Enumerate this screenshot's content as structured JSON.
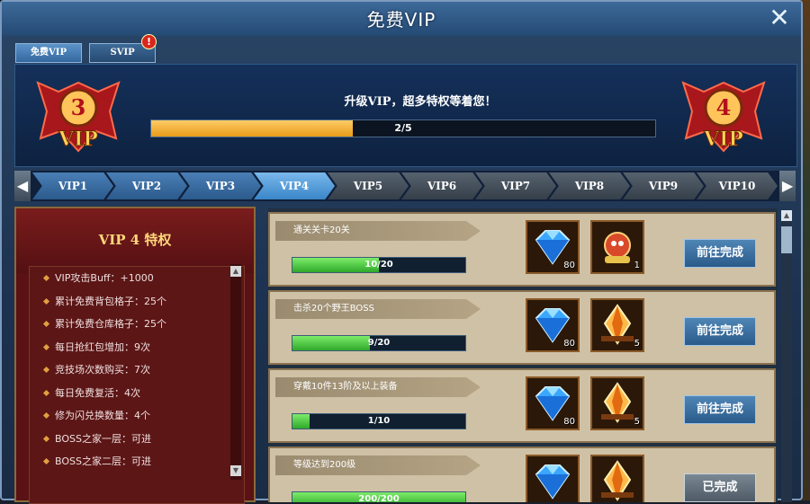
{
  "window": {
    "title": "免费VIP",
    "close_icon": "close-icon"
  },
  "tabs": [
    {
      "label": "免费VIP",
      "active": true
    },
    {
      "label": "SVIP",
      "active": false,
      "badge": "!"
    }
  ],
  "header": {
    "text": "升级VIP，超多特权等着您！",
    "current_level": "3",
    "next_level": "4",
    "badge_word": "VIP",
    "progress_text": "2/5",
    "progress": 0.4
  },
  "levels": [
    "VIP1",
    "VIP2",
    "VIP3",
    "VIP4",
    "VIP5",
    "VIP6",
    "VIP7",
    "VIP8",
    "VIP9",
    "VIP10"
  ],
  "selected_level": "VIP4",
  "privileges": {
    "title": "VIP 4 特权",
    "items": [
      "VIP攻击Buff：+1000",
      "累计免费背包格子：25个",
      "累计免费仓库格子：25个",
      "每日抢红包增加：9次",
      "竞技场次数购买：7次",
      "每日免费复活：4次",
      "修为闪兑换数量：4个",
      "BOSS之家一层：可进",
      "BOSS之家二层：可进"
    ]
  },
  "tasks": [
    {
      "name": "通关关卡20关",
      "progress_text": "10/20",
      "progress": 0.5,
      "rewards": [
        {
          "icon": "diamond-icon",
          "count": "80"
        },
        {
          "icon": "monkey-pet-icon",
          "count": "1"
        }
      ],
      "button": "前往完成",
      "done": false
    },
    {
      "name": "击杀20个野王BOSS",
      "progress_text": "9/20",
      "progress": 0.45,
      "rewards": [
        {
          "icon": "diamond-icon",
          "count": "80"
        },
        {
          "icon": "gold-crystal-icon",
          "count": "5"
        }
      ],
      "button": "前往完成",
      "done": false
    },
    {
      "name": "穿戴10件13阶及以上装备",
      "progress_text": "1/10",
      "progress": 0.1,
      "rewards": [
        {
          "icon": "diamond-icon",
          "count": "80"
        },
        {
          "icon": "gold-crystal-icon",
          "count": "5"
        }
      ],
      "button": "前往完成",
      "done": false
    },
    {
      "name": "等级达到200级",
      "progress_text": "200/200",
      "progress": 1.0,
      "rewards": [
        {
          "icon": "diamond-icon",
          "count": ""
        },
        {
          "icon": "gold-crystal-icon",
          "count": ""
        }
      ],
      "button": "已完成",
      "done": true
    }
  ],
  "colors": {
    "accent_blue": "#3a86c8",
    "panel_red": "#5a1214",
    "progress_orange": "#e89b1a",
    "progress_green": "#2fa82a"
  }
}
